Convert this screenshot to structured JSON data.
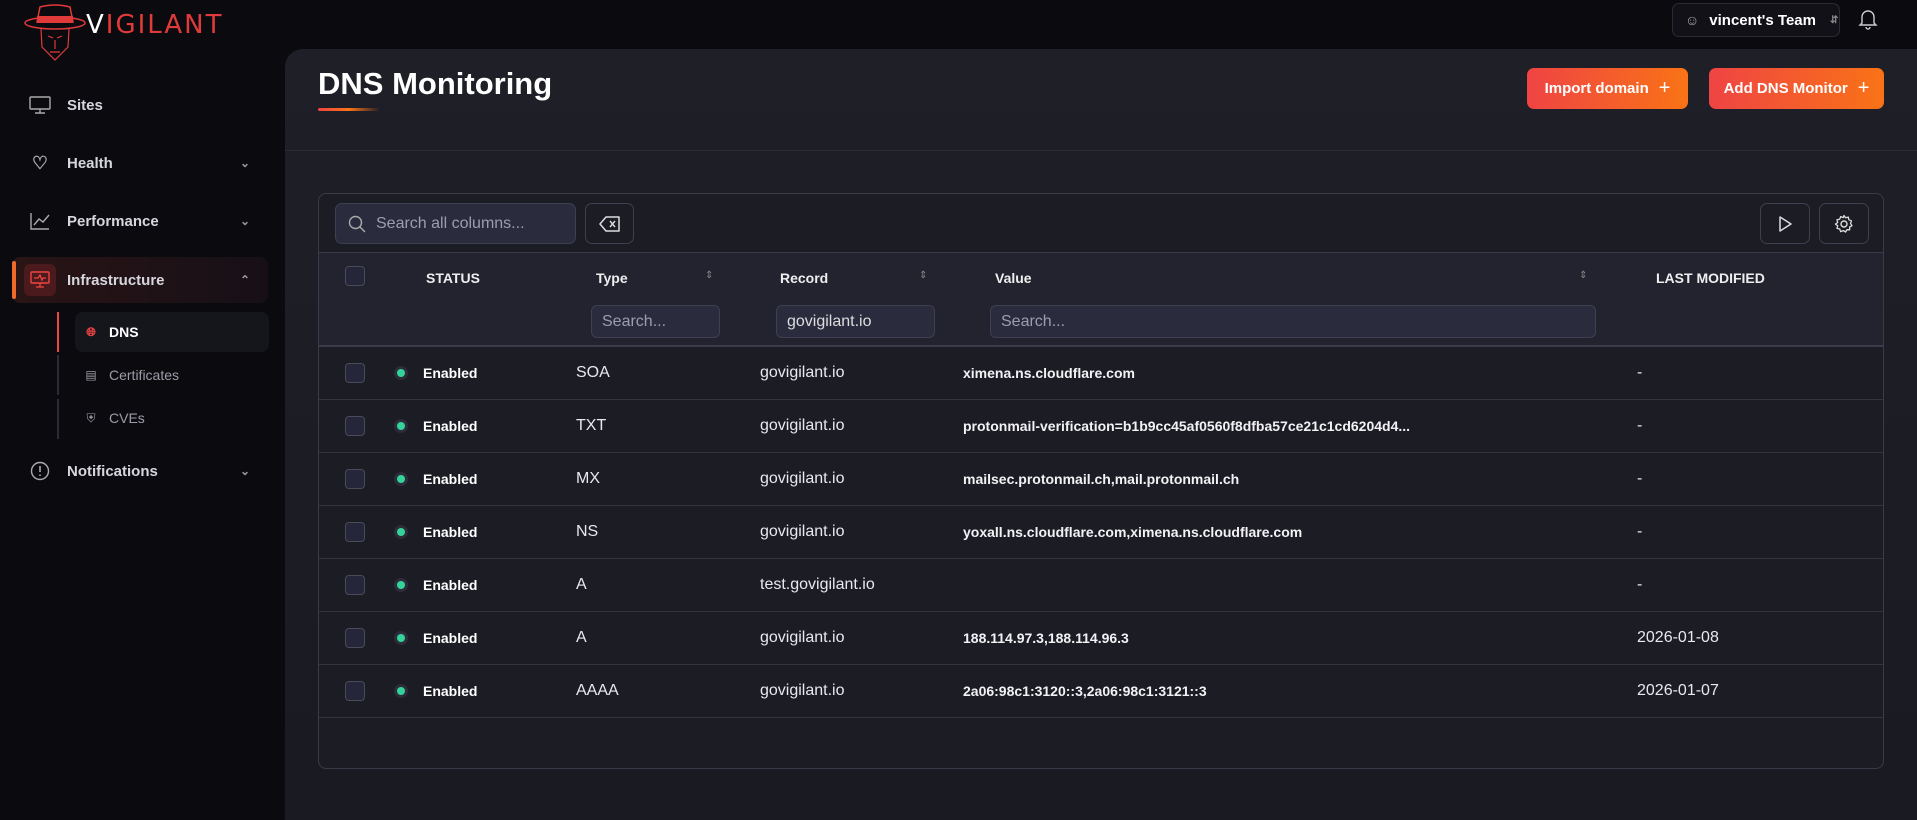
{
  "brand": {
    "name_first": "V",
    "name_rest": "IGILANT"
  },
  "team": {
    "name": "vincent's Team"
  },
  "sidebar": {
    "items": [
      {
        "label": "Sites"
      },
      {
        "label": "Health"
      },
      {
        "label": "Performance"
      },
      {
        "label": "Infrastructure"
      },
      {
        "label": "Notifications"
      }
    ],
    "sub_items": [
      {
        "label": "DNS"
      },
      {
        "label": "Certificates"
      },
      {
        "label": "CVEs"
      }
    ]
  },
  "page": {
    "title": "DNS Monitoring",
    "import_label": "Import domain",
    "add_label": "Add DNS Monitor"
  },
  "table": {
    "search_placeholder": "Search all columns...",
    "columns": {
      "status": "STATUS",
      "type": "Type",
      "record": "Record",
      "value": "Value",
      "last_modified": "LAST MODIFIED"
    },
    "filters": {
      "type_placeholder": "Search...",
      "record_value": "govigilant.io",
      "value_placeholder": "Search..."
    },
    "rows": [
      {
        "status": "Enabled",
        "type": "SOA",
        "record": "govigilant.io",
        "value": "ximena.ns.cloudflare.com",
        "last_modified": "-"
      },
      {
        "status": "Enabled",
        "type": "TXT",
        "record": "govigilant.io",
        "value": "protonmail-verification=b1b9cc45af0560f8dfba57ce21c1cd6204d4...",
        "last_modified": "-"
      },
      {
        "status": "Enabled",
        "type": "MX",
        "record": "govigilant.io",
        "value": "mailsec.protonmail.ch,mail.protonmail.ch",
        "last_modified": "-"
      },
      {
        "status": "Enabled",
        "type": "NS",
        "record": "govigilant.io",
        "value": "yoxall.ns.cloudflare.com,ximena.ns.cloudflare.com",
        "last_modified": "-"
      },
      {
        "status": "Enabled",
        "type": "A",
        "record": "test.govigilant.io",
        "value": "",
        "last_modified": "-"
      },
      {
        "status": "Enabled",
        "type": "A",
        "record": "govigilant.io",
        "value": "188.114.97.3,188.114.96.3",
        "last_modified": "2026-01-08"
      },
      {
        "status": "Enabled",
        "type": "AAAA",
        "record": "govigilant.io",
        "value": "2a06:98c1:3120::3,2a06:98c1:3121::3",
        "last_modified": "2026-01-07"
      }
    ]
  },
  "colors": {
    "accent_start": "#ef4444",
    "accent_end": "#f97316",
    "enabled": "#34d399"
  }
}
